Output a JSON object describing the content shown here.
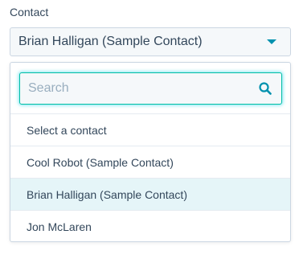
{
  "field": {
    "label": "Contact",
    "selected_value": "Brian Halligan (Sample Contact)"
  },
  "search": {
    "placeholder": "Search",
    "value": ""
  },
  "options": [
    {
      "label": "Select a contact",
      "selected": false
    },
    {
      "label": "Cool Robot (Sample Contact)",
      "selected": false
    },
    {
      "label": "Brian Halligan (Sample Contact)",
      "selected": true
    },
    {
      "label": "Jon McLaren",
      "selected": false
    }
  ],
  "colors": {
    "text": "#33475b",
    "accent": "#0091ae",
    "focus_border": "#00bda5",
    "selected_bg": "#e5f5f8",
    "border": "#cbd6e2"
  },
  "icons": {
    "dropdown": "caret-down-icon",
    "search": "search-icon"
  }
}
